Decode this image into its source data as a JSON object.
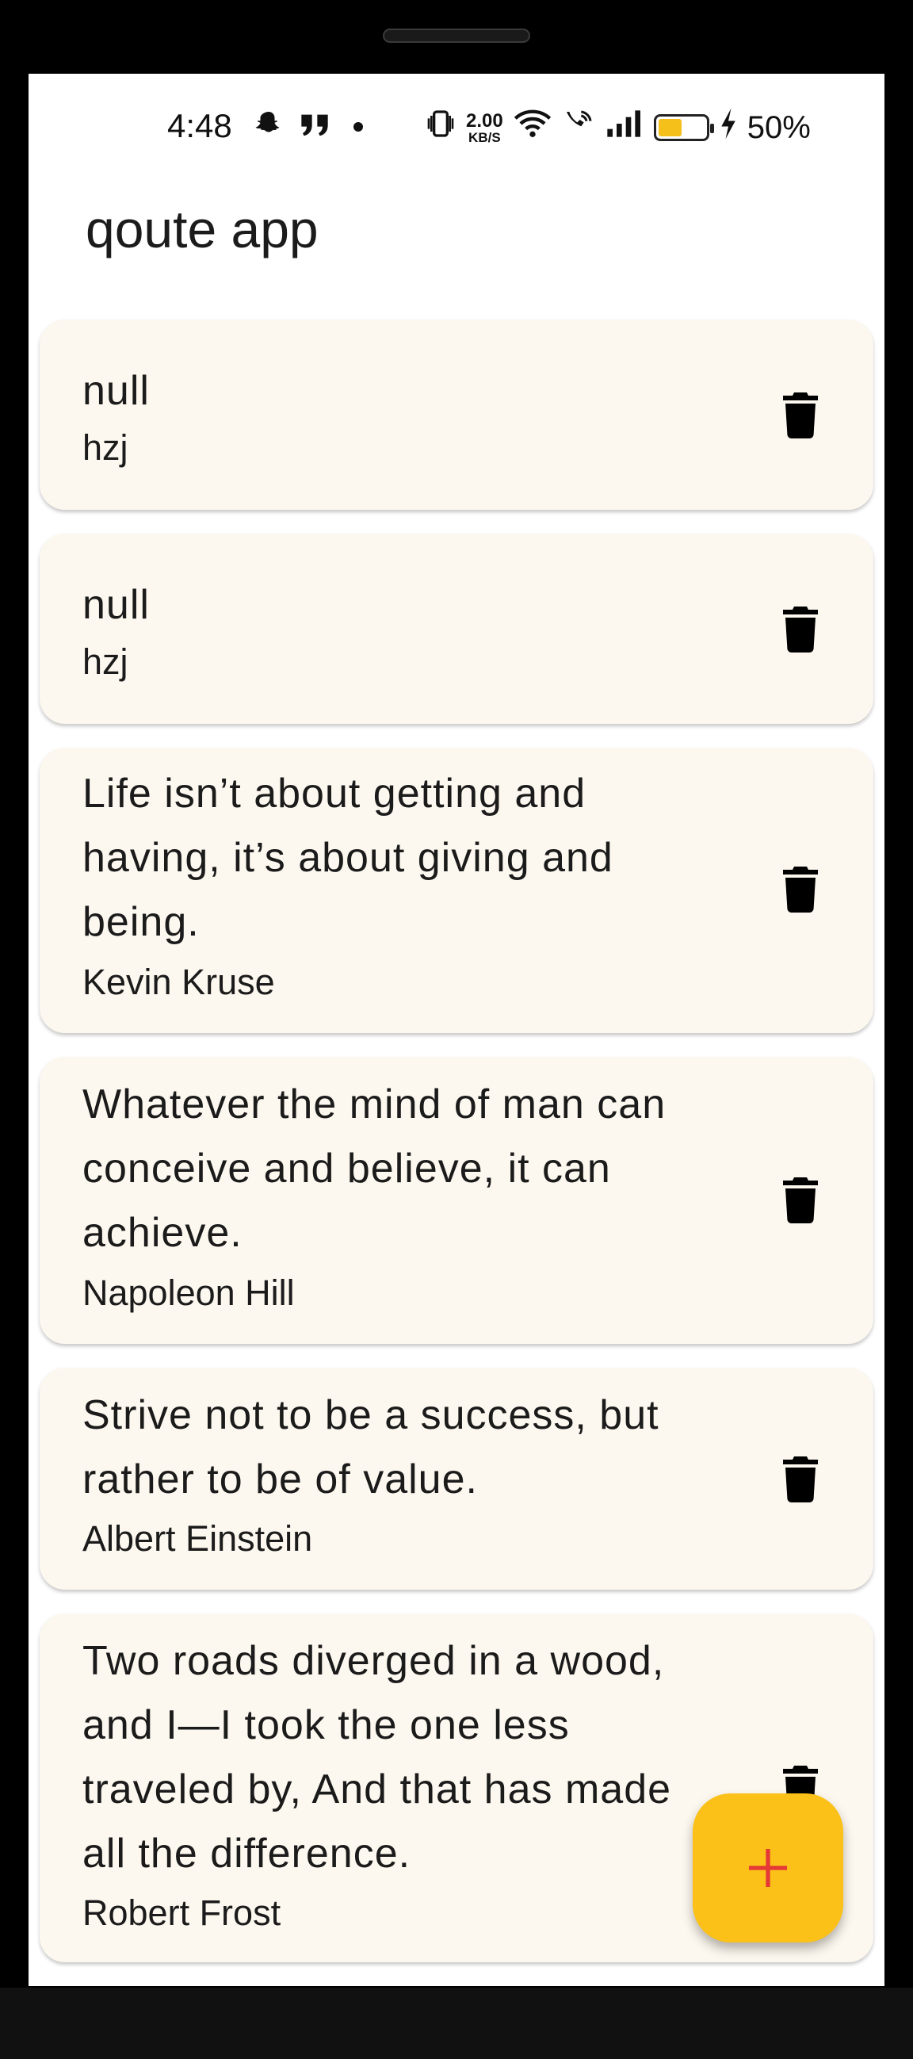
{
  "status_bar": {
    "time": "4:48",
    "net_speed_value": "2.00",
    "net_speed_unit": "KB/S",
    "battery_percent": "50%",
    "battery_level": 0.5,
    "icons": [
      "snapchat-icon",
      "quote-icon",
      "dot-icon",
      "vibrate-icon",
      "wifi-icon",
      "wifi-calling-icon",
      "signal-icon",
      "battery-icon",
      "charging-icon"
    ]
  },
  "app_bar": {
    "title": "qoute app"
  },
  "quotes": [
    {
      "text": "null",
      "author": "hzj"
    },
    {
      "text": "null",
      "author": "hzj"
    },
    {
      "text": "Life isn’t about getting and having, it’s about giving and being.",
      "author": "Kevin Kruse"
    },
    {
      "text": "Whatever the mind of man can conceive and believe, it can achieve.",
      "author": "Napoleon Hill"
    },
    {
      "text": "Strive not to be a success, but rather to be of value.",
      "author": "Albert Einstein"
    },
    {
      "text": "Two roads diverged in a wood, and I—I took the one less traveled by, And that has made all the difference.",
      "author": "Robert Frost"
    }
  ],
  "fab": {
    "icon": "plus-icon",
    "icon_color": "#e53935",
    "background": "#fbc118"
  },
  "colors": {
    "card_background": "#fdf8ef",
    "accent": "#fbc118"
  }
}
